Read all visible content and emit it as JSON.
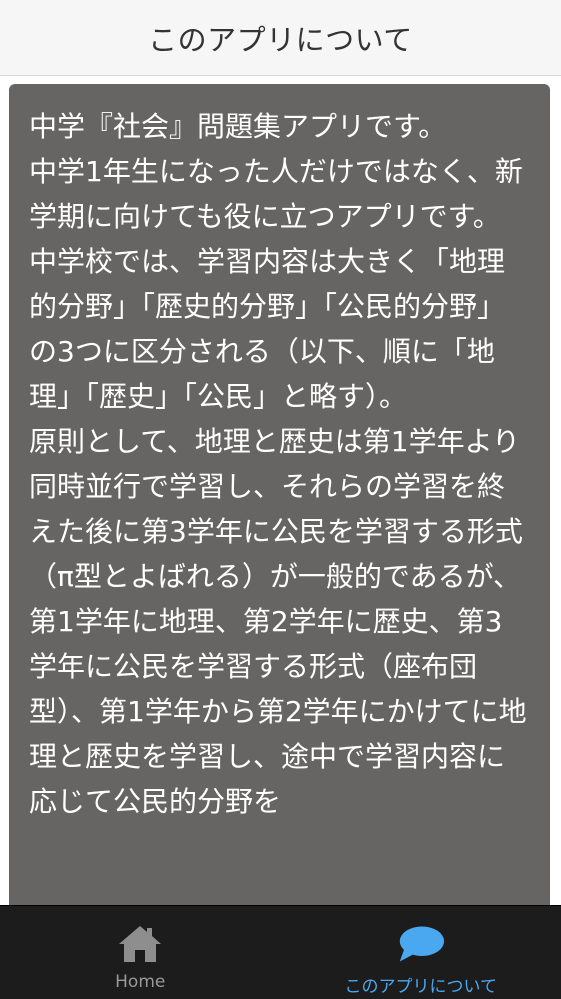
{
  "header": {
    "title": "このアプリについて"
  },
  "content": {
    "text": "中学『社会』問題集アプリです。\n中学1年生になった人だけではなく、新学期に向けても役に立つアプリです。\n中学校では、学習内容は大きく「地理的分野」「歴史的分野」「公民的分野」の3つに区分される（以下、順に「地理」「歴史」「公民」と略す）。\n原則として、地理と歴史は第1学年より同時並行で学習し、それらの学習を終えた後に第3学年に公民を学習する形式（π型とよばれる）が一般的であるが、第1学年に地理、第2学年に歴史、第3学年に公民を学習する形式（座布団型）、第1学年から第2学年にかけてに地理と歴史を学習し、途中で学習内容に応じて公民的分野を"
  },
  "tabbar": {
    "tabs": [
      {
        "label": "Home",
        "icon": "home-icon",
        "active": false
      },
      {
        "label": "このアプリについて",
        "icon": "speech-bubble-icon",
        "active": true
      }
    ]
  },
  "colors": {
    "header_bg": "#f6f6f6",
    "card_bg": "#676563",
    "tabbar_bg": "#1c1c1c",
    "tab_inactive": "#9a9a9a",
    "tab_active": "#4aa8f0"
  }
}
